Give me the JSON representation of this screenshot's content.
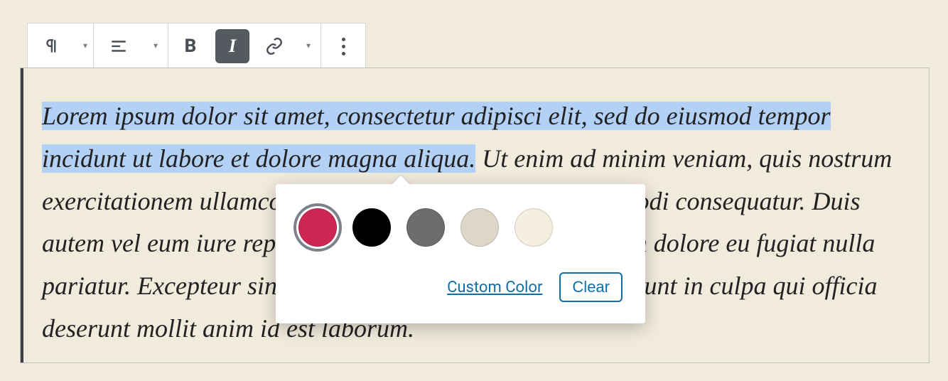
{
  "toolbar": {
    "block_type": "paragraph",
    "align": "left",
    "bold_label": "B",
    "italic_label": "I",
    "link_label": "link",
    "more_label": "more"
  },
  "paragraph": {
    "selected_a": "Lorem ipsum dolor sit amet, consectetur adipisci elit, sed do eiusmod tempor",
    "selected_b": "incidunt ut labore et dolore magna aliqua.",
    "rest": " Ut enim ad minim veniam, quis nostrum exercitationem ullamco laboris nisi ut aliquid ex ea commodi consequatur. Duis autem vel eum iure reprehenderit qui in ea velit esse cillum dolore eu fugiat nulla pariatur. Excepteur sint occaecat cupidatat non proident, sunt in culpa qui officia deserunt mollit anim id est laborum."
  },
  "color_popover": {
    "colors": [
      "#cd2653",
      "#000000",
      "#6d6d6d",
      "#dcd7ca",
      "#f5efe0"
    ],
    "selected_index": 0,
    "custom_label": "Custom Color",
    "clear_label": "Clear"
  }
}
